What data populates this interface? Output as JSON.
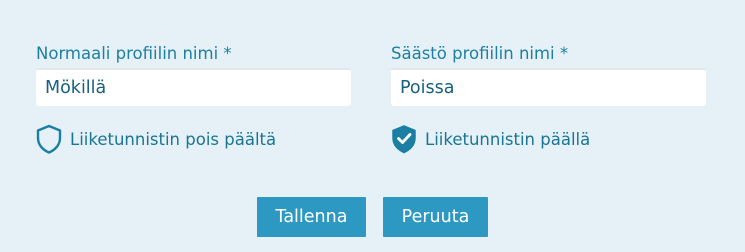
{
  "profiles": {
    "normal": {
      "label": "Normaali profiilin nimi *",
      "value": "Mökillä",
      "motion_label": "Liiketunnistin pois päältä",
      "motion_on": false,
      "motion_icon": "shield-outline-icon"
    },
    "saving": {
      "label": "Säästö profiilin nimi *",
      "value": "Poissa",
      "motion_label": "Liiketunnistin päällä",
      "motion_on": true,
      "motion_icon": "shield-check-icon"
    }
  },
  "actions": {
    "save_label": "Tallenna",
    "cancel_label": "Peruuta"
  },
  "colors": {
    "background": "#e5f1f7",
    "accent": "#2d98c1",
    "text": "#1f7fa1"
  }
}
